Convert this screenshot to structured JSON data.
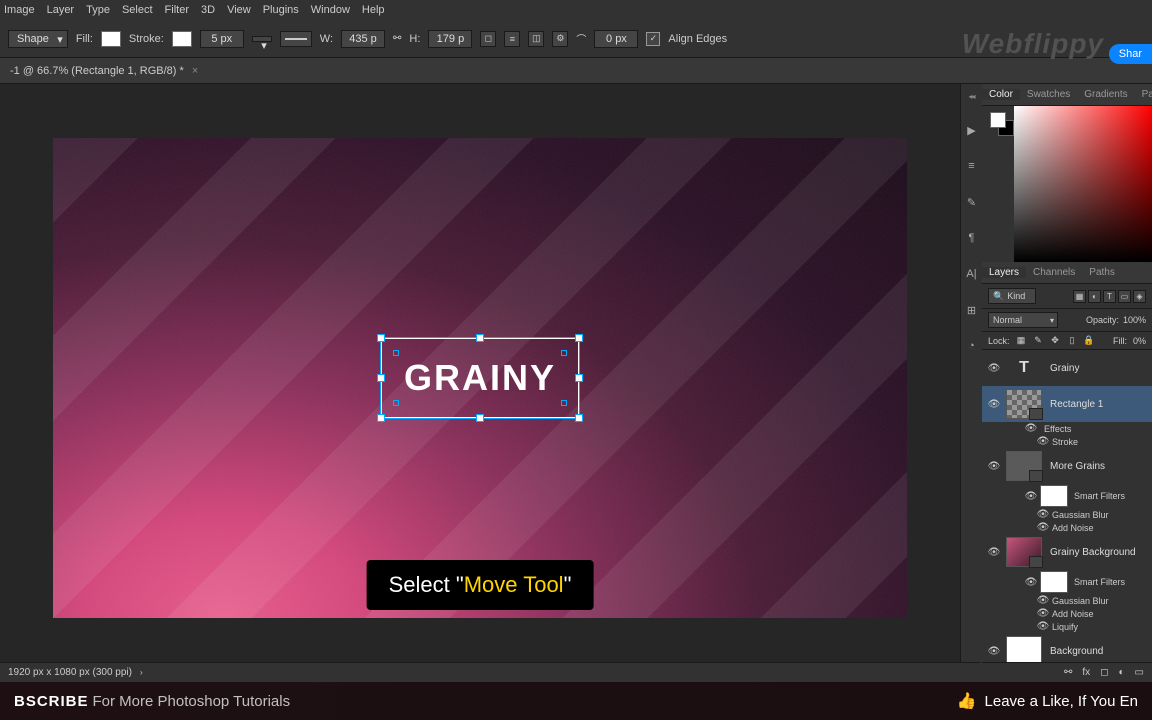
{
  "menu": [
    "Image",
    "Layer",
    "Type",
    "Select",
    "Filter",
    "3D",
    "View",
    "Plugins",
    "Window",
    "Help"
  ],
  "options": {
    "shape_label": "Shape",
    "fill_label": "Fill:",
    "stroke_label": "Stroke:",
    "stroke_width": "5 px",
    "w_label": "W:",
    "width_val": "435 p",
    "h_label": "H:",
    "height_val": "179 p",
    "round_val": "0 px",
    "align_edges_label": "Align Edges"
  },
  "watermark": "Webflippy",
  "share_label": "Shar",
  "doc_tab": "-1 @ 66.7% (Rectangle 1, RGB/8) *",
  "canvas_text": "GRAINY",
  "tooltip_pre": "Select \"",
  "tooltip_hi": "Move Tool",
  "tooltip_post": "\"",
  "color_tabs": [
    "Color",
    "Swatches",
    "Gradients",
    "Patte"
  ],
  "layers_tabs": [
    "Layers",
    "Channels",
    "Paths"
  ],
  "layers_filter_kind": "Kind",
  "blend_mode": "Normal",
  "opacity_label": "Opacity:",
  "opacity_val": "100%",
  "lock_label": "Lock:",
  "fill_label2": "Fill:",
  "fill_val": "0%",
  "layers": {
    "grainy": "Grainy",
    "rect": "Rectangle 1",
    "effects": "Effects",
    "stroke": "Stroke",
    "more_grains": "More Grains",
    "smart_filters": "Smart Filters",
    "gauss": "Gaussian Blur",
    "add_noise": "Add Noise",
    "grainy_bg": "Grainy Background",
    "liquify": "Liquify",
    "background": "Background"
  },
  "status": "1920 px x 1080 px (300 ppi)",
  "banner_bold": "BSCRIBE",
  "banner_rest": "For More Photoshop Tutorials",
  "banner_like": "Leave a Like, If You En"
}
